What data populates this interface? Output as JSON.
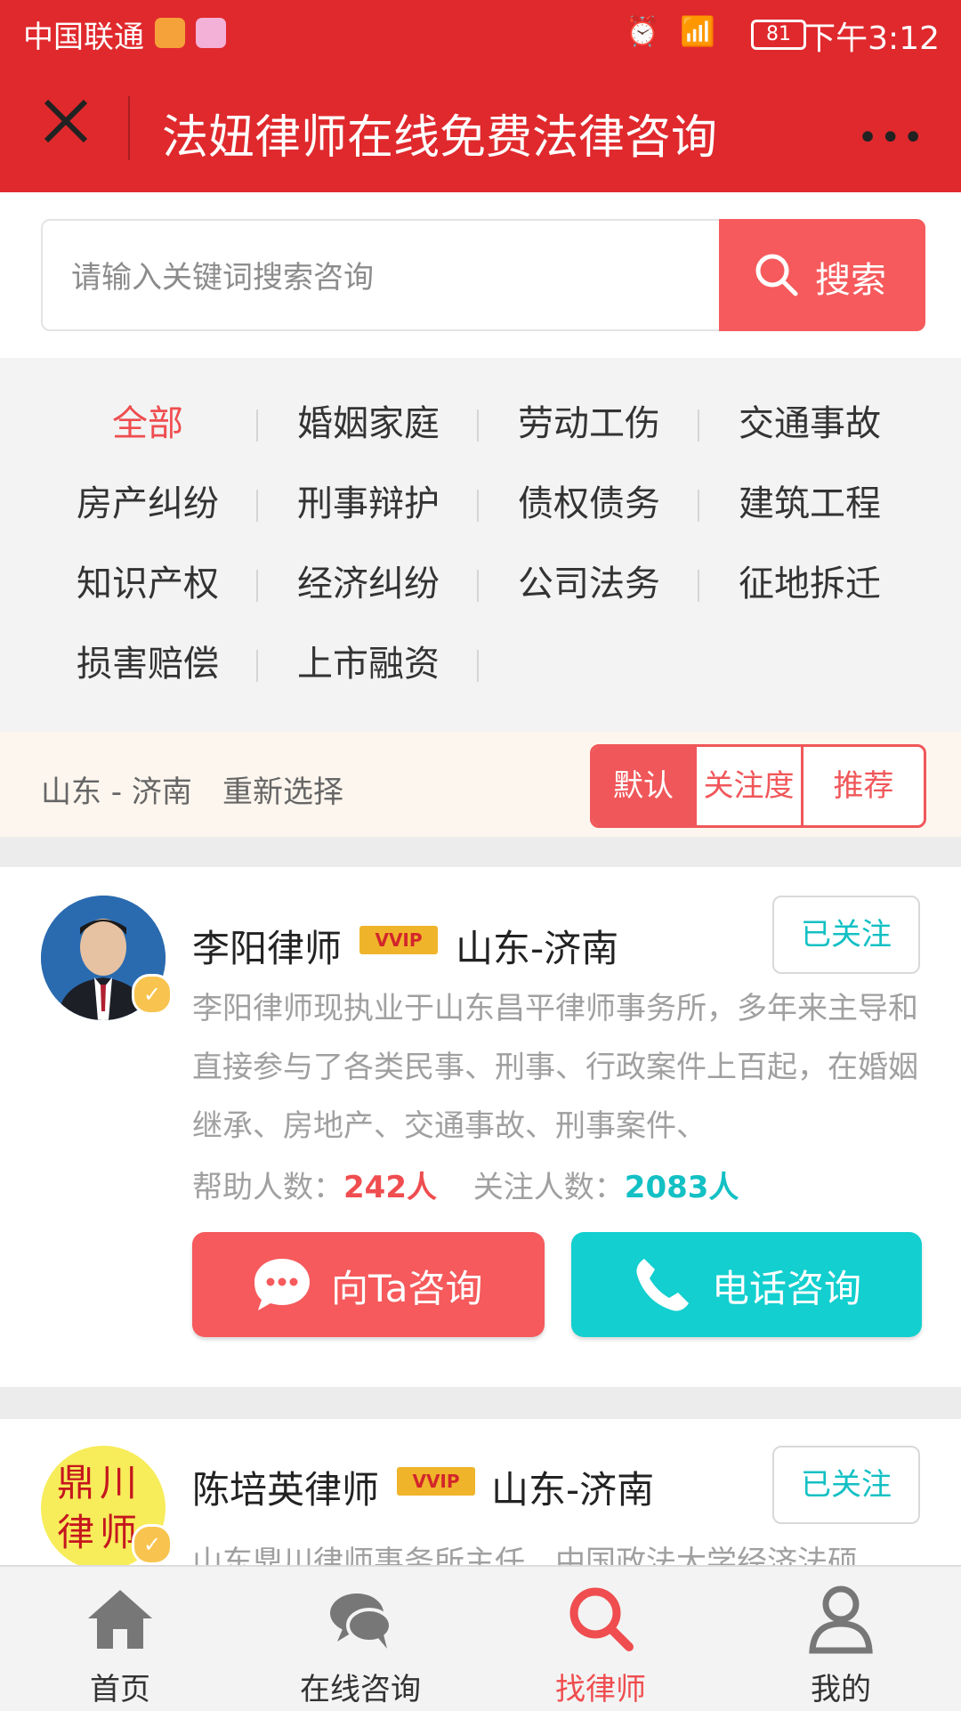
{
  "status_bar": {
    "carrier": "中国联通",
    "time": "下午3:12",
    "battery": "81",
    "network": "3G"
  },
  "titlebar": {
    "title": "法妞律师在线免费法律咨询",
    "more": "•••"
  },
  "search": {
    "placeholder": "请输入关键词搜索咨询",
    "button_label": "搜索"
  },
  "categories": [
    "全部",
    "婚姻家庭",
    "劳动工伤",
    "交通事故",
    "房产纠纷",
    "刑事辩护",
    "债权债务",
    "建筑工程",
    "知识产权",
    "经济纠纷",
    "公司法务",
    "征地拆迁",
    "损害赔偿",
    "上市融资"
  ],
  "filter": {
    "location": "山东 - 济南",
    "reselect": "重新选择",
    "sort_options": [
      "默认",
      "关注度",
      "推荐"
    ]
  },
  "lawyers": [
    {
      "name": "李阳律师",
      "vip": "VVIP",
      "city": "山东-济南",
      "follow_label": "已关注",
      "bio": "李阳律师现执业于山东昌平律师事务所，多年来主导和直接参与了各类民事、刑事、行政案件上百起，在婚姻继承、房地产、交通事故、刑事案件、",
      "helped_label": "帮助人数：",
      "helped_count": "242人",
      "followers_label": "关注人数：",
      "followers_count": "2083人",
      "consult_label": "向Ta咨询",
      "phone_label": "电话咨询"
    },
    {
      "name": "陈培英律师",
      "vip": "VVIP",
      "city": "山东-济南",
      "follow_label": "已关注",
      "bio": "山东鼎川律师事务所主任，中国政法大学经济法硕",
      "avatar_text": "鼎川律师"
    }
  ],
  "tabs": [
    "首页",
    "在线咨询",
    "找律师",
    "我的"
  ],
  "colors": {
    "brand_red": "#e0292d",
    "accent_red": "#f65a5c",
    "teal": "#13c0c4"
  }
}
